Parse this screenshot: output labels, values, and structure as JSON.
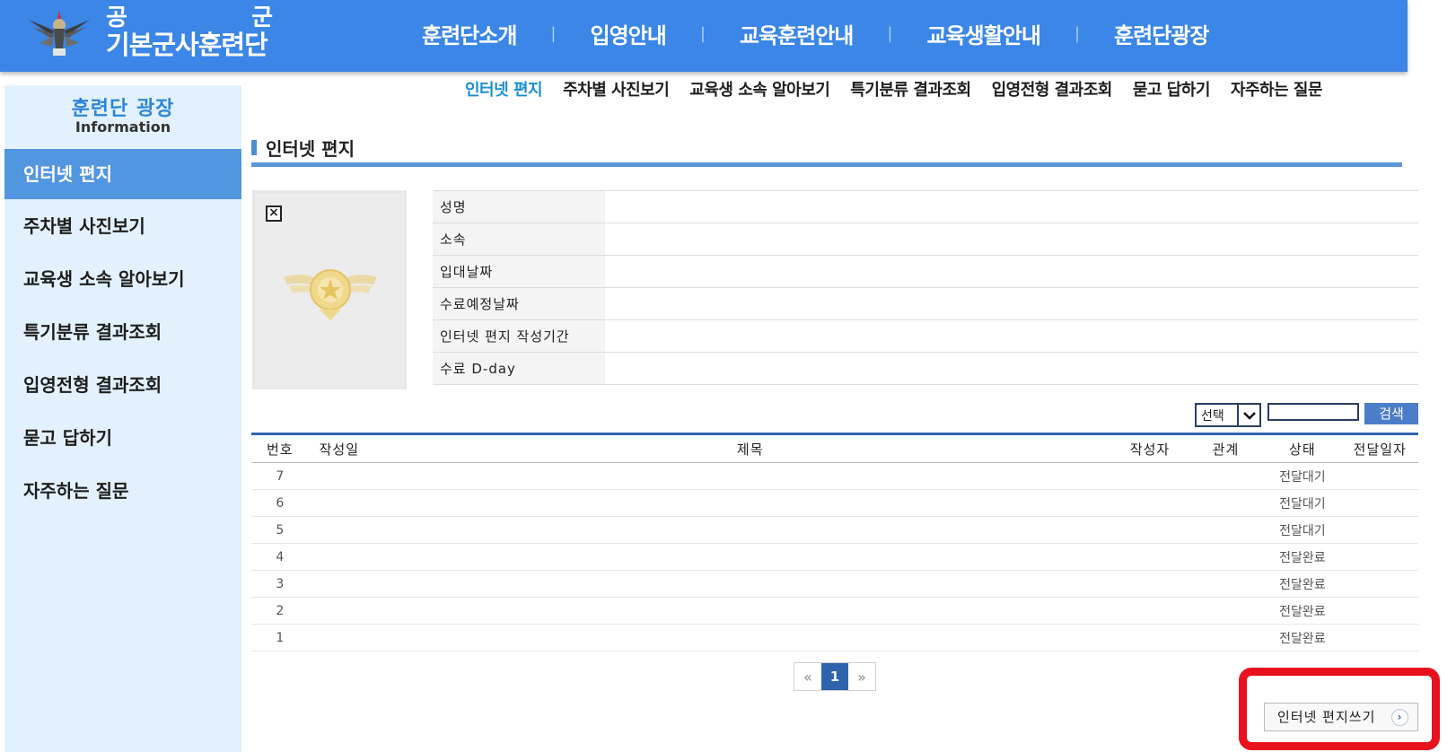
{
  "header": {
    "logo_line1_left": "공",
    "logo_line1_right": "군",
    "logo_line2": "기본군사훈련단",
    "nav": [
      "훈련단소개",
      "입영안내",
      "교육훈련안내",
      "교육생활안내",
      "훈련단광장"
    ]
  },
  "sidebar": {
    "title": "훈련단 광장",
    "subtitle": "Information",
    "items": [
      "인터넷 편지",
      "주차별 사진보기",
      "교육생 소속 알아보기",
      "특기분류 결과조회",
      "입영전형 결과조회",
      "묻고 답하기",
      "자주하는 질문"
    ],
    "active_index": 0
  },
  "subnav": {
    "items": [
      "인터넷 편지",
      "주차별 사진보기",
      "교육생 소속 알아보기",
      "특기분류 결과조회",
      "입영전형 결과조회",
      "묻고 답하기",
      "자주하는 질문"
    ],
    "active_index": 0
  },
  "page": {
    "title": "인터넷 편지"
  },
  "profile": {
    "broken_image_glyph": "×",
    "fields": [
      "성명",
      "소속",
      "입대날짜",
      "수료예정날짜",
      "인터넷 편지 작성기간",
      "수료 D-day"
    ]
  },
  "search": {
    "select_value": "선택",
    "button_label": "검색",
    "input_value": ""
  },
  "table": {
    "headers": [
      "번호",
      "작성일",
      "제목",
      "작성자",
      "관계",
      "상태",
      "전달일자"
    ],
    "rows": [
      {
        "no": "7",
        "status": "전달대기"
      },
      {
        "no": "6",
        "status": "전달대기"
      },
      {
        "no": "5",
        "status": "전달대기"
      },
      {
        "no": "4",
        "status": "전달완료"
      },
      {
        "no": "3",
        "status": "전달완료"
      },
      {
        "no": "2",
        "status": "전달완료"
      },
      {
        "no": "1",
        "status": "전달완료"
      }
    ]
  },
  "pagination": {
    "prev": "«",
    "current": "1",
    "next": "»"
  },
  "write_button": {
    "label": "인터넷 편지쓰기",
    "chevron": "›"
  },
  "colors": {
    "header_blue": "#3b86e6",
    "sidebar_bg": "#e2f1fd",
    "active_blue": "#5396e0",
    "highlight_red": "#e8121e"
  }
}
